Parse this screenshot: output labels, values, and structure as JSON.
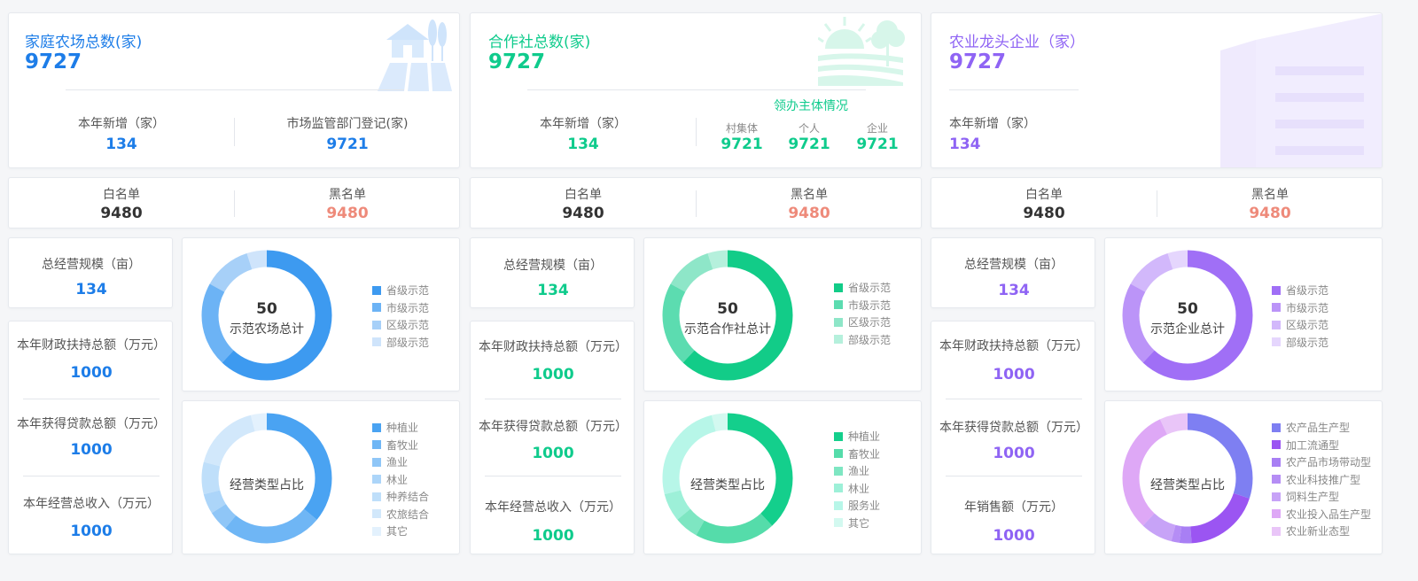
{
  "colors": {
    "blue": "#1d7de8",
    "green": "#0fcb8c",
    "purple": "#8f64f4",
    "red": "#ee8a7a"
  },
  "farm": {
    "title": "家庭农场总数(家)",
    "total": "9727",
    "new_label": "本年新增（家）",
    "new_value": "134",
    "reg_label": "市场监管部门登记(家)",
    "reg_value": "9721",
    "white_label": "白名单",
    "white_value": "9480",
    "black_label": "黑名单",
    "black_value": "9480",
    "scale_label": "总经营规模（亩）",
    "scale_value": "134",
    "fund_label": "本年财政扶持总额（万元）",
    "fund_value": "1000",
    "loan_label": "本年获得贷款总额（万元）",
    "loan_value": "1000",
    "income_label": "本年经营总收入（万元）",
    "income_value": "1000",
    "demo": {
      "value": "50",
      "label": "示范农场总计",
      "legend": [
        "省级示范",
        "市级示范",
        "区级示范",
        "部级示范"
      ],
      "colors": [
        "#3d9af0",
        "#6cb3f5",
        "#a7d0f8",
        "#cfe4fb"
      ],
      "shares": [
        0.62,
        0.21,
        0.12,
        0.05
      ]
    },
    "type": {
      "label": "经营类型占比",
      "legend": [
        "种植业",
        "畜牧业",
        "渔业",
        "林业",
        "种养结合",
        "农旅结合",
        "其它"
      ],
      "colors": [
        "#4aa3f2",
        "#6fb6f5",
        "#8fc6f7",
        "#acd5f9",
        "#bfdffa",
        "#d2e8fb",
        "#e3f1fd"
      ],
      "shares": [
        0.36,
        0.25,
        0.05,
        0.05,
        0.08,
        0.17,
        0.04
      ]
    }
  },
  "coop": {
    "title": "合作社总数(家)",
    "total": "9727",
    "new_label": "本年新增（家）",
    "new_value": "134",
    "lead_title": "领办主体情况",
    "lead_items": [
      {
        "label": "村集体",
        "value": "9721"
      },
      {
        "label": "个人",
        "value": "9721"
      },
      {
        "label": "企业",
        "value": "9721"
      }
    ],
    "white_label": "白名单",
    "white_value": "9480",
    "black_label": "黑名单",
    "black_value": "9480",
    "scale_label": "总经营规模（亩）",
    "scale_value": "134",
    "fund_label": "本年财政扶持总额（万元）",
    "fund_value": "1000",
    "loan_label": "本年获得贷款总额（万元）",
    "loan_value": "1000",
    "income_label": "本年经营总收入（万元）",
    "income_value": "1000",
    "demo": {
      "value": "50",
      "label": "示范合作社总计",
      "legend": [
        "省级示范",
        "市级示范",
        "区级示范",
        "部级示范"
      ],
      "colors": [
        "#12cc88",
        "#5cdcb0",
        "#8ee6c8",
        "#b5f0dc"
      ],
      "shares": [
        0.62,
        0.21,
        0.12,
        0.05
      ]
    },
    "type": {
      "label": "经营类型占比",
      "legend": [
        "种植业",
        "畜牧业",
        "渔业",
        "林业",
        "服务业",
        "其它"
      ],
      "colors": [
        "#14cf8c",
        "#55dcaa",
        "#7ee6c2",
        "#9df0d8",
        "#b7f6e8",
        "#d3f9f0"
      ],
      "shares": [
        0.38,
        0.2,
        0.06,
        0.07,
        0.25,
        0.04
      ]
    }
  },
  "ent": {
    "title": "农业龙头企业（家）",
    "total": "9727",
    "new_label": "本年新增（家）",
    "new_value": "134",
    "white_label": "白名单",
    "white_value": "9480",
    "black_label": "黑名单",
    "black_value": "9480",
    "scale_label": "总经营规模（亩）",
    "scale_value": "134",
    "fund_label": "本年财政扶持总额（万元）",
    "fund_value": "1000",
    "loan_label": "本年获得贷款总额（万元）",
    "loan_value": "1000",
    "income_label": "年销售额（万元）",
    "income_value": "1000",
    "demo": {
      "value": "50",
      "label": "示范企业总计",
      "legend": [
        "省级示范",
        "市级示范",
        "区级示范",
        "部级示范"
      ],
      "colors": [
        "#a06ff6",
        "#bb94f8",
        "#d2b8fb",
        "#e5d6fd"
      ],
      "shares": [
        0.62,
        0.21,
        0.12,
        0.05
      ]
    },
    "type": {
      "label": "经营类型占比",
      "legend": [
        "农产品生产型",
        "加工流通型",
        "农产品市场带动型",
        "农业科技推广型",
        "饲料生产型",
        "农业投入品生产型",
        "农业新业态型"
      ],
      "colors": [
        "#7e7ff2",
        "#9b55f2",
        "#a87ff4",
        "#b58df5",
        "#c7a3f7",
        "#dea8f6",
        "#e9c5f8"
      ],
      "shares": [
        0.3,
        0.19,
        0.03,
        0.02,
        0.08,
        0.31,
        0.07
      ]
    }
  }
}
